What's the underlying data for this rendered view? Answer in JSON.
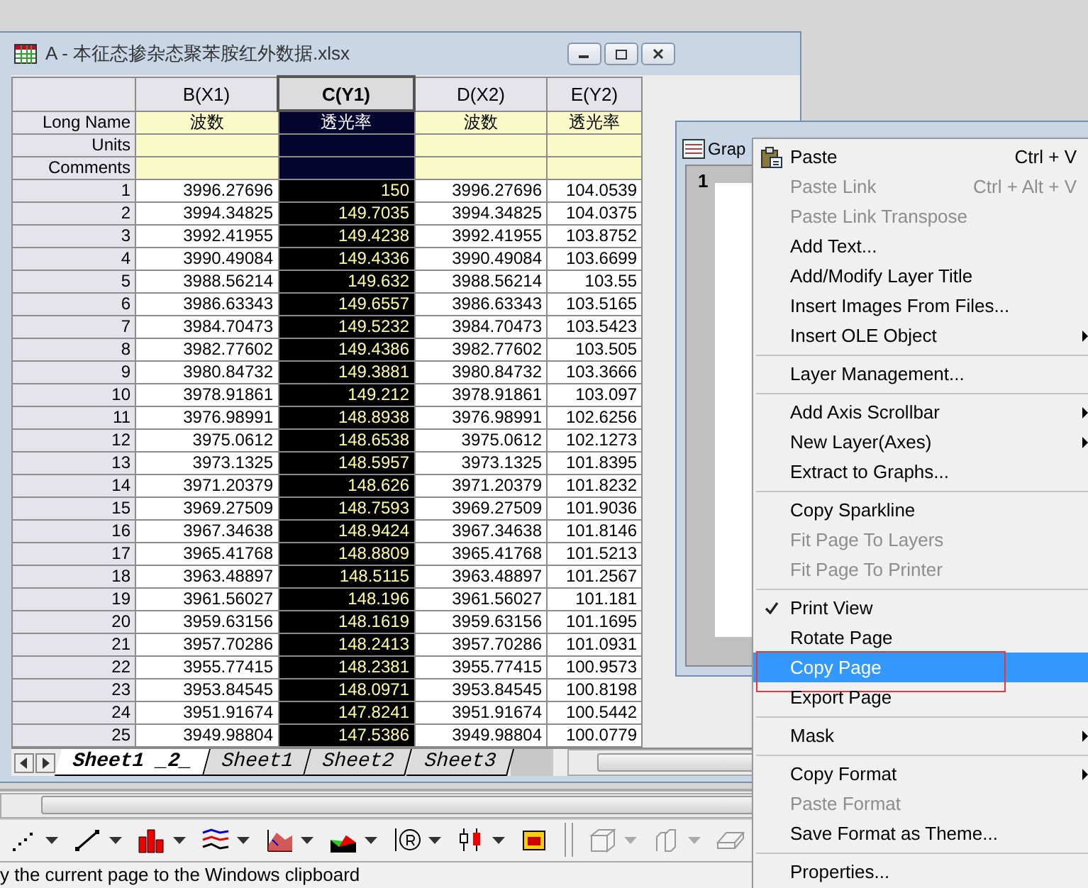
{
  "workbook": {
    "title": "A - 本征态掺杂态聚苯胺红外数据.xlsx",
    "label_rows": [
      "Long Name",
      "Units",
      "Comments"
    ],
    "columns": [
      {
        "label": "B(X1)",
        "long_name": "波数",
        "selected": false
      },
      {
        "label": "C(Y1)",
        "long_name": "透光率",
        "selected": true
      },
      {
        "label": "D(X2)",
        "long_name": "波数",
        "selected": false
      },
      {
        "label": "E(Y2)",
        "long_name": "透光率",
        "selected": false
      }
    ],
    "rows": [
      {
        "index": "1",
        "values": [
          "3996.27696",
          "150",
          "3996.27696",
          "104.0539"
        ]
      },
      {
        "index": "2",
        "values": [
          "3994.34825",
          "149.7035",
          "3994.34825",
          "104.0375"
        ]
      },
      {
        "index": "3",
        "values": [
          "3992.41955",
          "149.4238",
          "3992.41955",
          "103.8752"
        ]
      },
      {
        "index": "4",
        "values": [
          "3990.49084",
          "149.4336",
          "3990.49084",
          "103.6699"
        ]
      },
      {
        "index": "5",
        "values": [
          "3988.56214",
          "149.632",
          "3988.56214",
          "103.55"
        ]
      },
      {
        "index": "6",
        "values": [
          "3986.63343",
          "149.6557",
          "3986.63343",
          "103.5165"
        ]
      },
      {
        "index": "7",
        "values": [
          "3984.70473",
          "149.5232",
          "3984.70473",
          "103.5423"
        ]
      },
      {
        "index": "8",
        "values": [
          "3982.77602",
          "149.4386",
          "3982.77602",
          "103.505"
        ]
      },
      {
        "index": "9",
        "values": [
          "3980.84732",
          "149.3881",
          "3980.84732",
          "103.3666"
        ]
      },
      {
        "index": "10",
        "values": [
          "3978.91861",
          "149.212",
          "3978.91861",
          "103.097"
        ]
      },
      {
        "index": "11",
        "values": [
          "3976.98991",
          "148.8938",
          "3976.98991",
          "102.6256"
        ]
      },
      {
        "index": "12",
        "values": [
          "3975.0612",
          "148.6538",
          "3975.0612",
          "102.1273"
        ]
      },
      {
        "index": "13",
        "values": [
          "3973.1325",
          "148.5957",
          "3973.1325",
          "101.8395"
        ]
      },
      {
        "index": "14",
        "values": [
          "3971.20379",
          "148.626",
          "3971.20379",
          "101.8232"
        ]
      },
      {
        "index": "15",
        "values": [
          "3969.27509",
          "148.7593",
          "3969.27509",
          "101.9036"
        ]
      },
      {
        "index": "16",
        "values": [
          "3967.34638",
          "148.9424",
          "3967.34638",
          "101.8146"
        ]
      },
      {
        "index": "17",
        "values": [
          "3965.41768",
          "148.8809",
          "3965.41768",
          "101.5213"
        ]
      },
      {
        "index": "18",
        "values": [
          "3963.48897",
          "148.5115",
          "3963.48897",
          "101.2567"
        ]
      },
      {
        "index": "19",
        "values": [
          "3961.56027",
          "148.196",
          "3961.56027",
          "101.181"
        ]
      },
      {
        "index": "20",
        "values": [
          "3959.63156",
          "148.1619",
          "3959.63156",
          "101.1695"
        ]
      },
      {
        "index": "21",
        "values": [
          "3957.70286",
          "148.2413",
          "3957.70286",
          "101.0931"
        ]
      },
      {
        "index": "22",
        "values": [
          "3955.77415",
          "148.2381",
          "3955.77415",
          "100.9573"
        ]
      },
      {
        "index": "23",
        "values": [
          "3953.84545",
          "148.0971",
          "3953.84545",
          "100.8198"
        ]
      },
      {
        "index": "24",
        "values": [
          "3951.91674",
          "147.8241",
          "3951.91674",
          "100.5442"
        ]
      },
      {
        "index": "25",
        "values": [
          "3949.98804",
          "147.5386",
          "3949.98804",
          "100.0779"
        ]
      }
    ],
    "sheet_tabs": [
      {
        "label": "Sheet1 _2_",
        "selected": true
      },
      {
        "label": "Sheet1",
        "selected": false
      },
      {
        "label": "Sheet2",
        "selected": false
      },
      {
        "label": "Sheet3",
        "selected": false
      }
    ]
  },
  "graph_window": {
    "title": "Grap",
    "layer": "1"
  },
  "context_menu": [
    {
      "kind": "item",
      "label": "Paste",
      "shortcut": "Ctrl + V",
      "icon": true,
      "disabled": false
    },
    {
      "kind": "item",
      "label": "Paste Link",
      "shortcut": "Ctrl + Alt + V",
      "disabled": true
    },
    {
      "kind": "item",
      "label": "Paste Link Transpose",
      "disabled": true
    },
    {
      "kind": "item",
      "label": "Add Text...",
      "disabled": false
    },
    {
      "kind": "item",
      "label": "Add/Modify Layer Title",
      "disabled": false
    },
    {
      "kind": "item",
      "label": "Insert Images From Files...",
      "disabled": false
    },
    {
      "kind": "item",
      "label": "Insert OLE Object",
      "disabled": false,
      "submenu": true
    },
    {
      "kind": "separator"
    },
    {
      "kind": "item",
      "label": "Layer Management...",
      "disabled": false
    },
    {
      "kind": "separator"
    },
    {
      "kind": "item",
      "label": "Add Axis Scrollbar",
      "disabled": false,
      "submenu": true
    },
    {
      "kind": "item",
      "label": "New Layer(Axes)",
      "disabled": false,
      "submenu": true
    },
    {
      "kind": "item",
      "label": "Extract to Graphs...",
      "disabled": false
    },
    {
      "kind": "separator"
    },
    {
      "kind": "item",
      "label": "Copy Sparkline",
      "disabled": false
    },
    {
      "kind": "item",
      "label": "Fit Page To Layers",
      "disabled": true
    },
    {
      "kind": "item",
      "label": "Fit Page To Printer",
      "disabled": true
    },
    {
      "kind": "separator"
    },
    {
      "kind": "item",
      "label": "Print View",
      "disabled": false,
      "checked": true
    },
    {
      "kind": "item",
      "label": "Rotate Page",
      "disabled": false
    },
    {
      "kind": "item",
      "label": "Copy Page",
      "disabled": false,
      "selected": true,
      "annotated": true
    },
    {
      "kind": "item",
      "label": "Export Page",
      "disabled": false
    },
    {
      "kind": "separator"
    },
    {
      "kind": "item",
      "label": "Mask",
      "disabled": false,
      "submenu": true
    },
    {
      "kind": "separator"
    },
    {
      "kind": "item",
      "label": "Copy Format",
      "disabled": false,
      "submenu": true
    },
    {
      "kind": "item",
      "label": "Paste Format",
      "disabled": true
    },
    {
      "kind": "item",
      "label": "Save Format as Theme...",
      "disabled": false
    },
    {
      "kind": "separator"
    },
    {
      "kind": "item",
      "label": "Properties...",
      "disabled": false
    }
  ],
  "status_bar": {
    "text": "y the current page to the Windows clipboard"
  }
}
